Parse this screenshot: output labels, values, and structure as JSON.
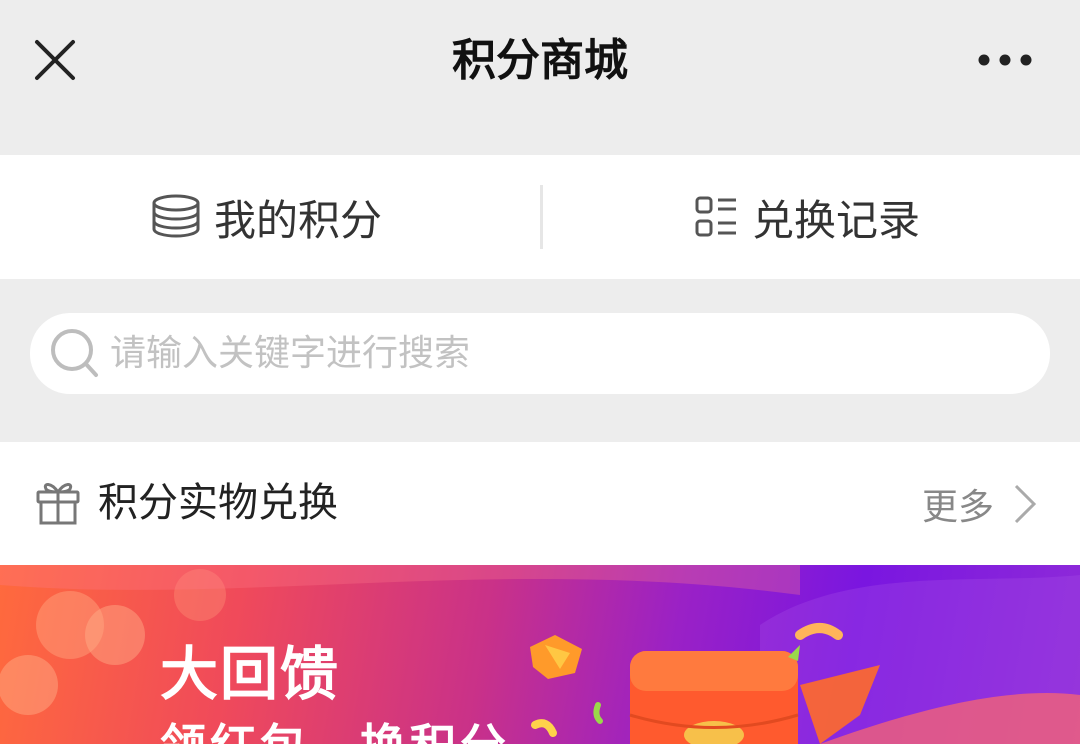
{
  "header": {
    "title": "积分商城",
    "close_icon": "close-icon",
    "more_icon": "more-dots-icon"
  },
  "quick_nav": {
    "my_points": {
      "label": "我的积分",
      "icon": "coin-stack-icon"
    },
    "exchange_records": {
      "label": "兑换记录",
      "icon": "list-icon"
    }
  },
  "search": {
    "placeholder": "请输入关键字进行搜索",
    "value": "",
    "icon": "search-icon"
  },
  "section": {
    "title": "积分实物兑换",
    "icon": "gift-icon",
    "more_label": "更多",
    "more_icon": "chevron-right-icon"
  },
  "banner": {
    "title": "大回馈",
    "subtitle": "领红包，换积分"
  },
  "colors": {
    "background": "#ededed",
    "card": "#ffffff",
    "banner_start": "#ff6a3d",
    "banner_end": "#7a16e0"
  }
}
